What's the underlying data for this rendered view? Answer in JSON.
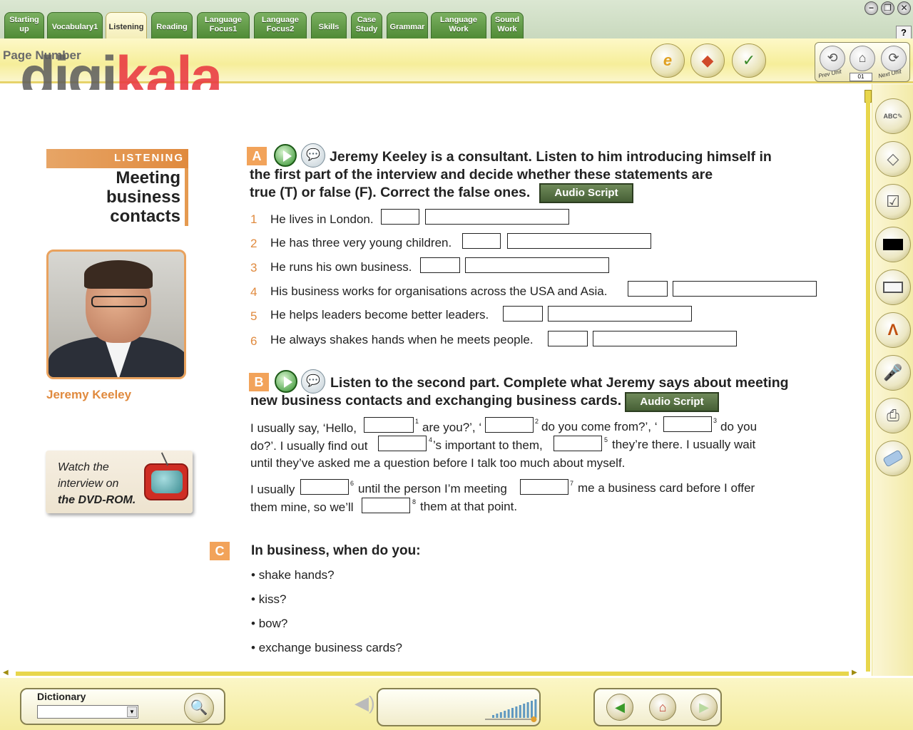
{
  "window": {
    "tabs": [
      {
        "line1": "Starting",
        "line2": "up"
      },
      {
        "line1": "Vocabulary1",
        "line2": ""
      },
      {
        "line1": "Listening",
        "line2": ""
      },
      {
        "line1": "Reading",
        "line2": ""
      },
      {
        "line1": "Language",
        "line2": "Focus1"
      },
      {
        "line1": "Language",
        "line2": "Focus2"
      },
      {
        "line1": "Skills",
        "line2": ""
      },
      {
        "line1": "Case",
        "line2": "Study"
      },
      {
        "line1": "Grammar",
        "line2": ""
      },
      {
        "line1": "Language",
        "line2": "Work"
      },
      {
        "line1": "Sound",
        "line2": "Work"
      }
    ],
    "active_tab": "Listening",
    "controls": {
      "minimize": "−",
      "restore": "❐",
      "close": "✕",
      "help": "?"
    }
  },
  "toolbar": {
    "page_number_label": "Page Number",
    "logo_part1": "digi",
    "logo_part2": "kala",
    "tools": [
      "edit-icon",
      "chart-icon",
      "answers-icon"
    ],
    "answers_label": "Answers",
    "unit_nav": {
      "prev": "Prev Unit",
      "next": "Next Unit",
      "unit_value": "01",
      "prev_glyph": "⟲",
      "home_glyph": "⌂",
      "next_glyph": "⟳"
    }
  },
  "left_column": {
    "section_banner": "LISTENING",
    "lesson_title": [
      "Meeting",
      "business",
      "contacts"
    ],
    "person_name": "Jeremy Keeley",
    "dvd_line1": "Watch the",
    "dvd_line2": "interview on",
    "dvd_line3": "the DVD-ROM."
  },
  "section_a": {
    "letter": "A",
    "instruction_lines": [
      "Jeremy Keeley is a consultant. Listen to him introducing himself in",
      "the first part of the interview and decide whether these statements are",
      "true (T) or false (F). Correct the false ones."
    ],
    "audio_script_label": "Audio Script",
    "statements": [
      {
        "num": "1",
        "text": "He lives in London."
      },
      {
        "num": "2",
        "text": "He has three very young children."
      },
      {
        "num": "3",
        "text": "He runs his own business."
      },
      {
        "num": "4",
        "text": "His business works for organisations across the USA and Asia."
      },
      {
        "num": "5",
        "text": "He helps leaders become better leaders."
      },
      {
        "num": "6",
        "text": "He always shakes hands when he meets people."
      }
    ]
  },
  "section_b": {
    "letter": "B",
    "instruction_lines": [
      "Listen to the second part. Complete what Jeremy says about meeting",
      "new business contacts and exchanging business cards."
    ],
    "audio_script_label": "Audio Script",
    "cloze": {
      "l1a": "I usually say, ‘Hello,",
      "s1": "1",
      "l1b": "are you?’, ‘",
      "s2": "2",
      "l1c": "do you come from?’, ‘",
      "s3": "3",
      "l1d": "do you",
      "l2a": "do?’. I usually find out",
      "s4": "4",
      "l2b": "’s important to them,",
      "s5": "5",
      "l2c": "they’re there. I usually wait",
      "l3": "until they’ve asked me a question before I talk too much about myself.",
      "l4a": "I usually",
      "s6": "6",
      "l4b": "until the person I’m meeting",
      "s7": "7",
      "l4c": "me a business card before I offer",
      "l5a": "them mine, so we’ll",
      "s8": "8",
      "l5b": "them at that point."
    }
  },
  "section_c": {
    "letter": "C",
    "question": "In business, when do you:",
    "bullets": [
      "shake hands?",
      "kiss?",
      "bow?",
      "exchange business cards?"
    ]
  },
  "right_tools": [
    "abc-pencil-icon",
    "eraser-note-icon",
    "checklist-pencil-icon",
    "black-rectangle-icon",
    "rectangle-outline-icon",
    "compass-icon",
    "microphone-icon",
    "printer-icon",
    "eraser-icon"
  ],
  "bottom": {
    "dictionary_label": "Dictionary",
    "dictionary_value": "",
    "volume_level": 0.95,
    "nav": {
      "back": "◀",
      "home": "⌂",
      "forward": "▶"
    }
  },
  "colors": {
    "accent_orange": "#e59a50",
    "tab_green": "#4f8a35",
    "toolbar_yellow": "#f6ee9a",
    "audio_btn": "#4f6a3d"
  }
}
